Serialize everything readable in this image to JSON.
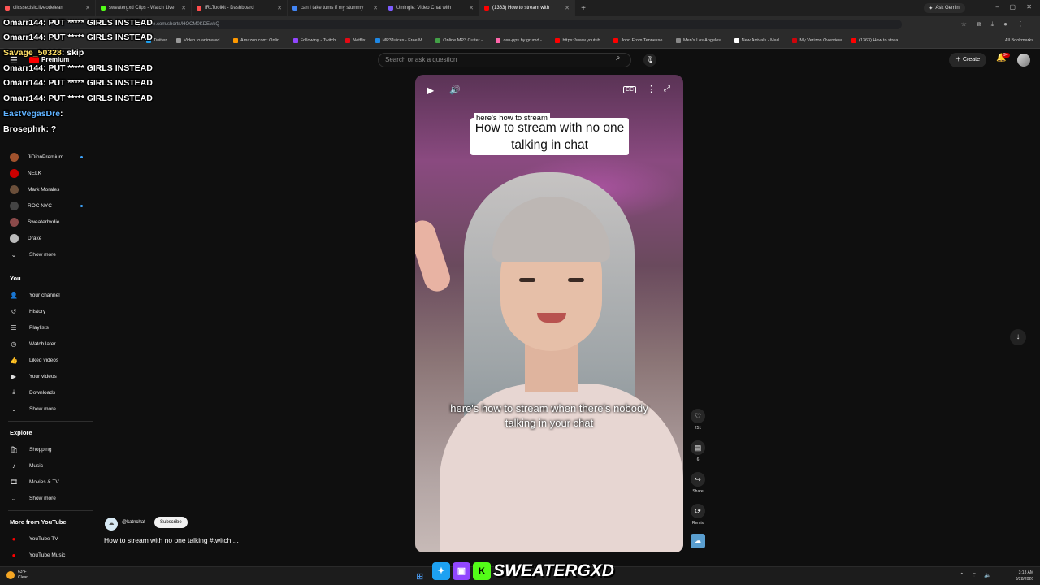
{
  "browser": {
    "tabs": [
      {
        "label": "clicssecisic.liveodeiean",
        "color": "#ff5555"
      },
      {
        "label": "sweatergxd Clips - Watch Live",
        "color": "#53fc18"
      },
      {
        "label": "IRLToolkit - Dashboard",
        "color": "#ff4d4d"
      },
      {
        "label": "can i take tums if my stummy",
        "color": "#4285f4"
      },
      {
        "label": "Umingle: Video Chat with",
        "color": "#7d5cff"
      },
      {
        "label": "(1363) How to stream with",
        "color": "#ff0000"
      }
    ],
    "ask_gemini": "Ask Gemini",
    "url": "youtube.com/shorts/HOCM0KDEwkQ",
    "bookmarks": [
      {
        "label": "Twitter",
        "color": "#1da1f2"
      },
      {
        "label": "Video to animated...",
        "color": "#999999"
      },
      {
        "label": "Amazon.com: Onlin...",
        "color": "#ff9900"
      },
      {
        "label": "Following - Twitch",
        "color": "#9146ff"
      },
      {
        "label": "Netflix",
        "color": "#e50914"
      },
      {
        "label": "MP3Juices - Free M...",
        "color": "#1e88e5"
      },
      {
        "label": "Online MP3 Cutter -...",
        "color": "#43a047"
      },
      {
        "label": "osu-pps by grumd -...",
        "color": "#ff66aa"
      },
      {
        "label": "https://www.youtub...",
        "color": "#ff0000"
      },
      {
        "label": "John From Tennesse...",
        "color": "#ff0000"
      },
      {
        "label": "Men's Los Angeles...",
        "color": "#888888"
      },
      {
        "label": "New Arrivals - Mad...",
        "color": "#ffffff"
      },
      {
        "label": "My Verizon Overview",
        "color": "#cd040b"
      },
      {
        "label": "(1363) How to strea...",
        "color": "#ff0000"
      }
    ],
    "all_bookmarks": "All Bookmarks"
  },
  "youtube": {
    "premium_label": "Premium",
    "search_placeholder": "Search or ask a question",
    "create_label": "Create",
    "notif_count": "9+"
  },
  "chat": [
    {
      "user": "Omarr144",
      "msg": ": PUT ***** GIRLS INSTEAD",
      "cls": "user"
    },
    {
      "user": "Omarr144",
      "msg": ": PUT ***** GIRLS INSTEAD",
      "cls": "user"
    },
    {
      "user": "Savage_50328",
      "msg": ": skip",
      "cls": "u-yel"
    },
    {
      "user": "Omarr144",
      "msg": ": PUT ***** GIRLS INSTEAD",
      "cls": "user"
    },
    {
      "user": "Omarr144",
      "msg": ": PUT ***** GIRLS INSTEAD",
      "cls": "user"
    },
    {
      "user": "Omarr144",
      "msg": ": PUT ***** GIRLS INSTEAD",
      "cls": "user"
    },
    {
      "user": "EastVegasDre",
      "msg": ":",
      "cls": "u-blue"
    },
    {
      "user": "Brosephrk",
      "msg": ": ?",
      "cls": "user"
    }
  ],
  "sidebar": {
    "subs": [
      {
        "label": "JiDionPremium",
        "color": "#a0522d",
        "live": true
      },
      {
        "label": "NELK",
        "color": "#cc0000",
        "live": false
      },
      {
        "label": "Mark Morales",
        "color": "#6b4f3a",
        "live": false
      },
      {
        "label": "ROC NYC",
        "color": "#444444",
        "live": true
      },
      {
        "label": "Sweaterbxdie",
        "color": "#8b4a4a",
        "live": false
      },
      {
        "label": "Drake",
        "color": "#bbbbbb",
        "live": false
      }
    ],
    "show_more_1": "Show more",
    "you_heading": "You",
    "you_items": [
      {
        "label": "Your channel",
        "icon": "👤"
      },
      {
        "label": "History",
        "icon": "↺"
      },
      {
        "label": "Playlists",
        "icon": "☰"
      },
      {
        "label": "Watch later",
        "icon": "◷"
      },
      {
        "label": "Liked videos",
        "icon": "👍"
      },
      {
        "label": "Your videos",
        "icon": "▶"
      },
      {
        "label": "Downloads",
        "icon": "⤓"
      }
    ],
    "show_more_2": "Show more",
    "explore_heading": "Explore",
    "explore_items": [
      {
        "label": "Shopping",
        "icon": "🛍"
      },
      {
        "label": "Music",
        "icon": "♪"
      },
      {
        "label": "Movies & TV",
        "icon": "🎞"
      }
    ],
    "show_more_3": "Show more",
    "more_heading": "More from YouTube",
    "more_items": [
      {
        "label": "YouTube TV",
        "color": "#ff0000"
      },
      {
        "label": "YouTube Music",
        "color": "#ff0000"
      }
    ]
  },
  "short": {
    "caption_small": "here's how to stream",
    "caption_title": "How to stream with no one talking in chat",
    "caption_sub": "here's how to stream when there's nobody talking in your chat",
    "likes": "251",
    "comments": "6",
    "share_label": "Share",
    "remix_label": "Remix",
    "channel": "@katnchat",
    "subscribe_label": "Subscribe",
    "title": "How to stream with no one talking #twitch ..."
  },
  "taskbar": {
    "temp": "63°F",
    "weather": "Clear",
    "brand": "SWEATERGXD",
    "time": "3:13 AM",
    "date": "6/28/2026"
  }
}
